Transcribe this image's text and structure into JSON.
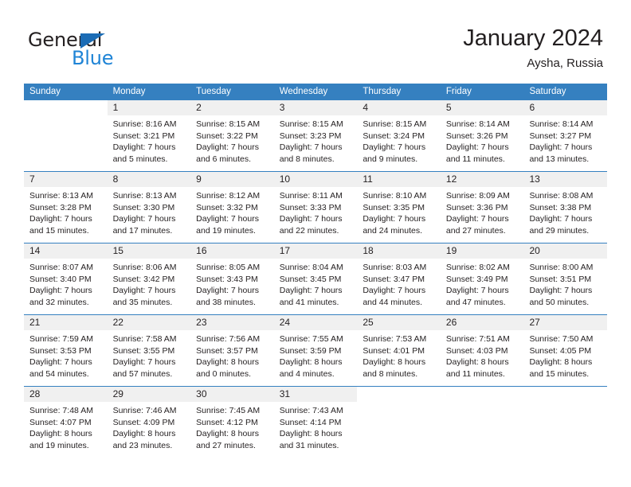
{
  "brand": {
    "name_top": "General",
    "name_bottom": "Blue",
    "accent_color": "#1f84d6",
    "triangle_color": "#1b6cb5"
  },
  "header": {
    "title": "January 2024",
    "location": "Aysha, Russia"
  },
  "theme": {
    "header_row_bg": "#3580c0",
    "daynum_bg": "#f0f0f0",
    "text_color": "#231f20"
  },
  "weekdays": [
    "Sunday",
    "Monday",
    "Tuesday",
    "Wednesday",
    "Thursday",
    "Friday",
    "Saturday"
  ],
  "labels": {
    "sunrise": "Sunrise:",
    "sunset": "Sunset:",
    "daylight": "Daylight:"
  },
  "weeks": [
    [
      {
        "day": "",
        "empty": true
      },
      {
        "day": "1",
        "sunrise": "Sunrise: 8:16 AM",
        "sunset": "Sunset: 3:21 PM",
        "daylight1": "Daylight: 7 hours",
        "daylight2": "and 5 minutes."
      },
      {
        "day": "2",
        "sunrise": "Sunrise: 8:15 AM",
        "sunset": "Sunset: 3:22 PM",
        "daylight1": "Daylight: 7 hours",
        "daylight2": "and 6 minutes."
      },
      {
        "day": "3",
        "sunrise": "Sunrise: 8:15 AM",
        "sunset": "Sunset: 3:23 PM",
        "daylight1": "Daylight: 7 hours",
        "daylight2": "and 8 minutes."
      },
      {
        "day": "4",
        "sunrise": "Sunrise: 8:15 AM",
        "sunset": "Sunset: 3:24 PM",
        "daylight1": "Daylight: 7 hours",
        "daylight2": "and 9 minutes."
      },
      {
        "day": "5",
        "sunrise": "Sunrise: 8:14 AM",
        "sunset": "Sunset: 3:26 PM",
        "daylight1": "Daylight: 7 hours",
        "daylight2": "and 11 minutes."
      },
      {
        "day": "6",
        "sunrise": "Sunrise: 8:14 AM",
        "sunset": "Sunset: 3:27 PM",
        "daylight1": "Daylight: 7 hours",
        "daylight2": "and 13 minutes."
      }
    ],
    [
      {
        "day": "7",
        "sunrise": "Sunrise: 8:13 AM",
        "sunset": "Sunset: 3:28 PM",
        "daylight1": "Daylight: 7 hours",
        "daylight2": "and 15 minutes."
      },
      {
        "day": "8",
        "sunrise": "Sunrise: 8:13 AM",
        "sunset": "Sunset: 3:30 PM",
        "daylight1": "Daylight: 7 hours",
        "daylight2": "and 17 minutes."
      },
      {
        "day": "9",
        "sunrise": "Sunrise: 8:12 AM",
        "sunset": "Sunset: 3:32 PM",
        "daylight1": "Daylight: 7 hours",
        "daylight2": "and 19 minutes."
      },
      {
        "day": "10",
        "sunrise": "Sunrise: 8:11 AM",
        "sunset": "Sunset: 3:33 PM",
        "daylight1": "Daylight: 7 hours",
        "daylight2": "and 22 minutes."
      },
      {
        "day": "11",
        "sunrise": "Sunrise: 8:10 AM",
        "sunset": "Sunset: 3:35 PM",
        "daylight1": "Daylight: 7 hours",
        "daylight2": "and 24 minutes."
      },
      {
        "day": "12",
        "sunrise": "Sunrise: 8:09 AM",
        "sunset": "Sunset: 3:36 PM",
        "daylight1": "Daylight: 7 hours",
        "daylight2": "and 27 minutes."
      },
      {
        "day": "13",
        "sunrise": "Sunrise: 8:08 AM",
        "sunset": "Sunset: 3:38 PM",
        "daylight1": "Daylight: 7 hours",
        "daylight2": "and 29 minutes."
      }
    ],
    [
      {
        "day": "14",
        "sunrise": "Sunrise: 8:07 AM",
        "sunset": "Sunset: 3:40 PM",
        "daylight1": "Daylight: 7 hours",
        "daylight2": "and 32 minutes."
      },
      {
        "day": "15",
        "sunrise": "Sunrise: 8:06 AM",
        "sunset": "Sunset: 3:42 PM",
        "daylight1": "Daylight: 7 hours",
        "daylight2": "and 35 minutes."
      },
      {
        "day": "16",
        "sunrise": "Sunrise: 8:05 AM",
        "sunset": "Sunset: 3:43 PM",
        "daylight1": "Daylight: 7 hours",
        "daylight2": "and 38 minutes."
      },
      {
        "day": "17",
        "sunrise": "Sunrise: 8:04 AM",
        "sunset": "Sunset: 3:45 PM",
        "daylight1": "Daylight: 7 hours",
        "daylight2": "and 41 minutes."
      },
      {
        "day": "18",
        "sunrise": "Sunrise: 8:03 AM",
        "sunset": "Sunset: 3:47 PM",
        "daylight1": "Daylight: 7 hours",
        "daylight2": "and 44 minutes."
      },
      {
        "day": "19",
        "sunrise": "Sunrise: 8:02 AM",
        "sunset": "Sunset: 3:49 PM",
        "daylight1": "Daylight: 7 hours",
        "daylight2": "and 47 minutes."
      },
      {
        "day": "20",
        "sunrise": "Sunrise: 8:00 AM",
        "sunset": "Sunset: 3:51 PM",
        "daylight1": "Daylight: 7 hours",
        "daylight2": "and 50 minutes."
      }
    ],
    [
      {
        "day": "21",
        "sunrise": "Sunrise: 7:59 AM",
        "sunset": "Sunset: 3:53 PM",
        "daylight1": "Daylight: 7 hours",
        "daylight2": "and 54 minutes."
      },
      {
        "day": "22",
        "sunrise": "Sunrise: 7:58 AM",
        "sunset": "Sunset: 3:55 PM",
        "daylight1": "Daylight: 7 hours",
        "daylight2": "and 57 minutes."
      },
      {
        "day": "23",
        "sunrise": "Sunrise: 7:56 AM",
        "sunset": "Sunset: 3:57 PM",
        "daylight1": "Daylight: 8 hours",
        "daylight2": "and 0 minutes."
      },
      {
        "day": "24",
        "sunrise": "Sunrise: 7:55 AM",
        "sunset": "Sunset: 3:59 PM",
        "daylight1": "Daylight: 8 hours",
        "daylight2": "and 4 minutes."
      },
      {
        "day": "25",
        "sunrise": "Sunrise: 7:53 AM",
        "sunset": "Sunset: 4:01 PM",
        "daylight1": "Daylight: 8 hours",
        "daylight2": "and 8 minutes."
      },
      {
        "day": "26",
        "sunrise": "Sunrise: 7:51 AM",
        "sunset": "Sunset: 4:03 PM",
        "daylight1": "Daylight: 8 hours",
        "daylight2": "and 11 minutes."
      },
      {
        "day": "27",
        "sunrise": "Sunrise: 7:50 AM",
        "sunset": "Sunset: 4:05 PM",
        "daylight1": "Daylight: 8 hours",
        "daylight2": "and 15 minutes."
      }
    ],
    [
      {
        "day": "28",
        "sunrise": "Sunrise: 7:48 AM",
        "sunset": "Sunset: 4:07 PM",
        "daylight1": "Daylight: 8 hours",
        "daylight2": "and 19 minutes."
      },
      {
        "day": "29",
        "sunrise": "Sunrise: 7:46 AM",
        "sunset": "Sunset: 4:09 PM",
        "daylight1": "Daylight: 8 hours",
        "daylight2": "and 23 minutes."
      },
      {
        "day": "30",
        "sunrise": "Sunrise: 7:45 AM",
        "sunset": "Sunset: 4:12 PM",
        "daylight1": "Daylight: 8 hours",
        "daylight2": "and 27 minutes."
      },
      {
        "day": "31",
        "sunrise": "Sunrise: 7:43 AM",
        "sunset": "Sunset: 4:14 PM",
        "daylight1": "Daylight: 8 hours",
        "daylight2": "and 31 minutes."
      },
      {
        "day": "",
        "empty": true
      },
      {
        "day": "",
        "empty": true
      },
      {
        "day": "",
        "empty": true
      }
    ]
  ]
}
